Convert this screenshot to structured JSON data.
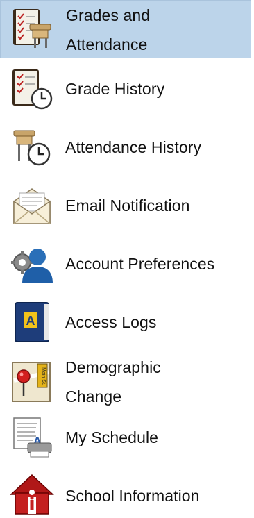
{
  "nav": {
    "items": [
      {
        "label": "Grades and\nAttendance",
        "selected": true,
        "icon": "gradebook-desk-icon"
      },
      {
        "label": "Grade History",
        "icon": "gradebook-clock-icon"
      },
      {
        "label": "Attendance History",
        "icon": "desk-clock-icon"
      },
      {
        "label": "Email Notification",
        "icon": "envelope-icon"
      },
      {
        "label": "Account Preferences",
        "icon": "user-gear-icon"
      },
      {
        "label": "Access Logs",
        "icon": "log-book-icon"
      },
      {
        "label": "Demographic\nChange",
        "icon": "map-pin-icon"
      },
      {
        "label": "My Schedule",
        "icon": "schedule-printer-icon"
      },
      {
        "label": "School Information",
        "icon": "school-house-icon"
      }
    ]
  },
  "colors": {
    "selected_bg": "#bcd4ea",
    "text": "#111111"
  }
}
